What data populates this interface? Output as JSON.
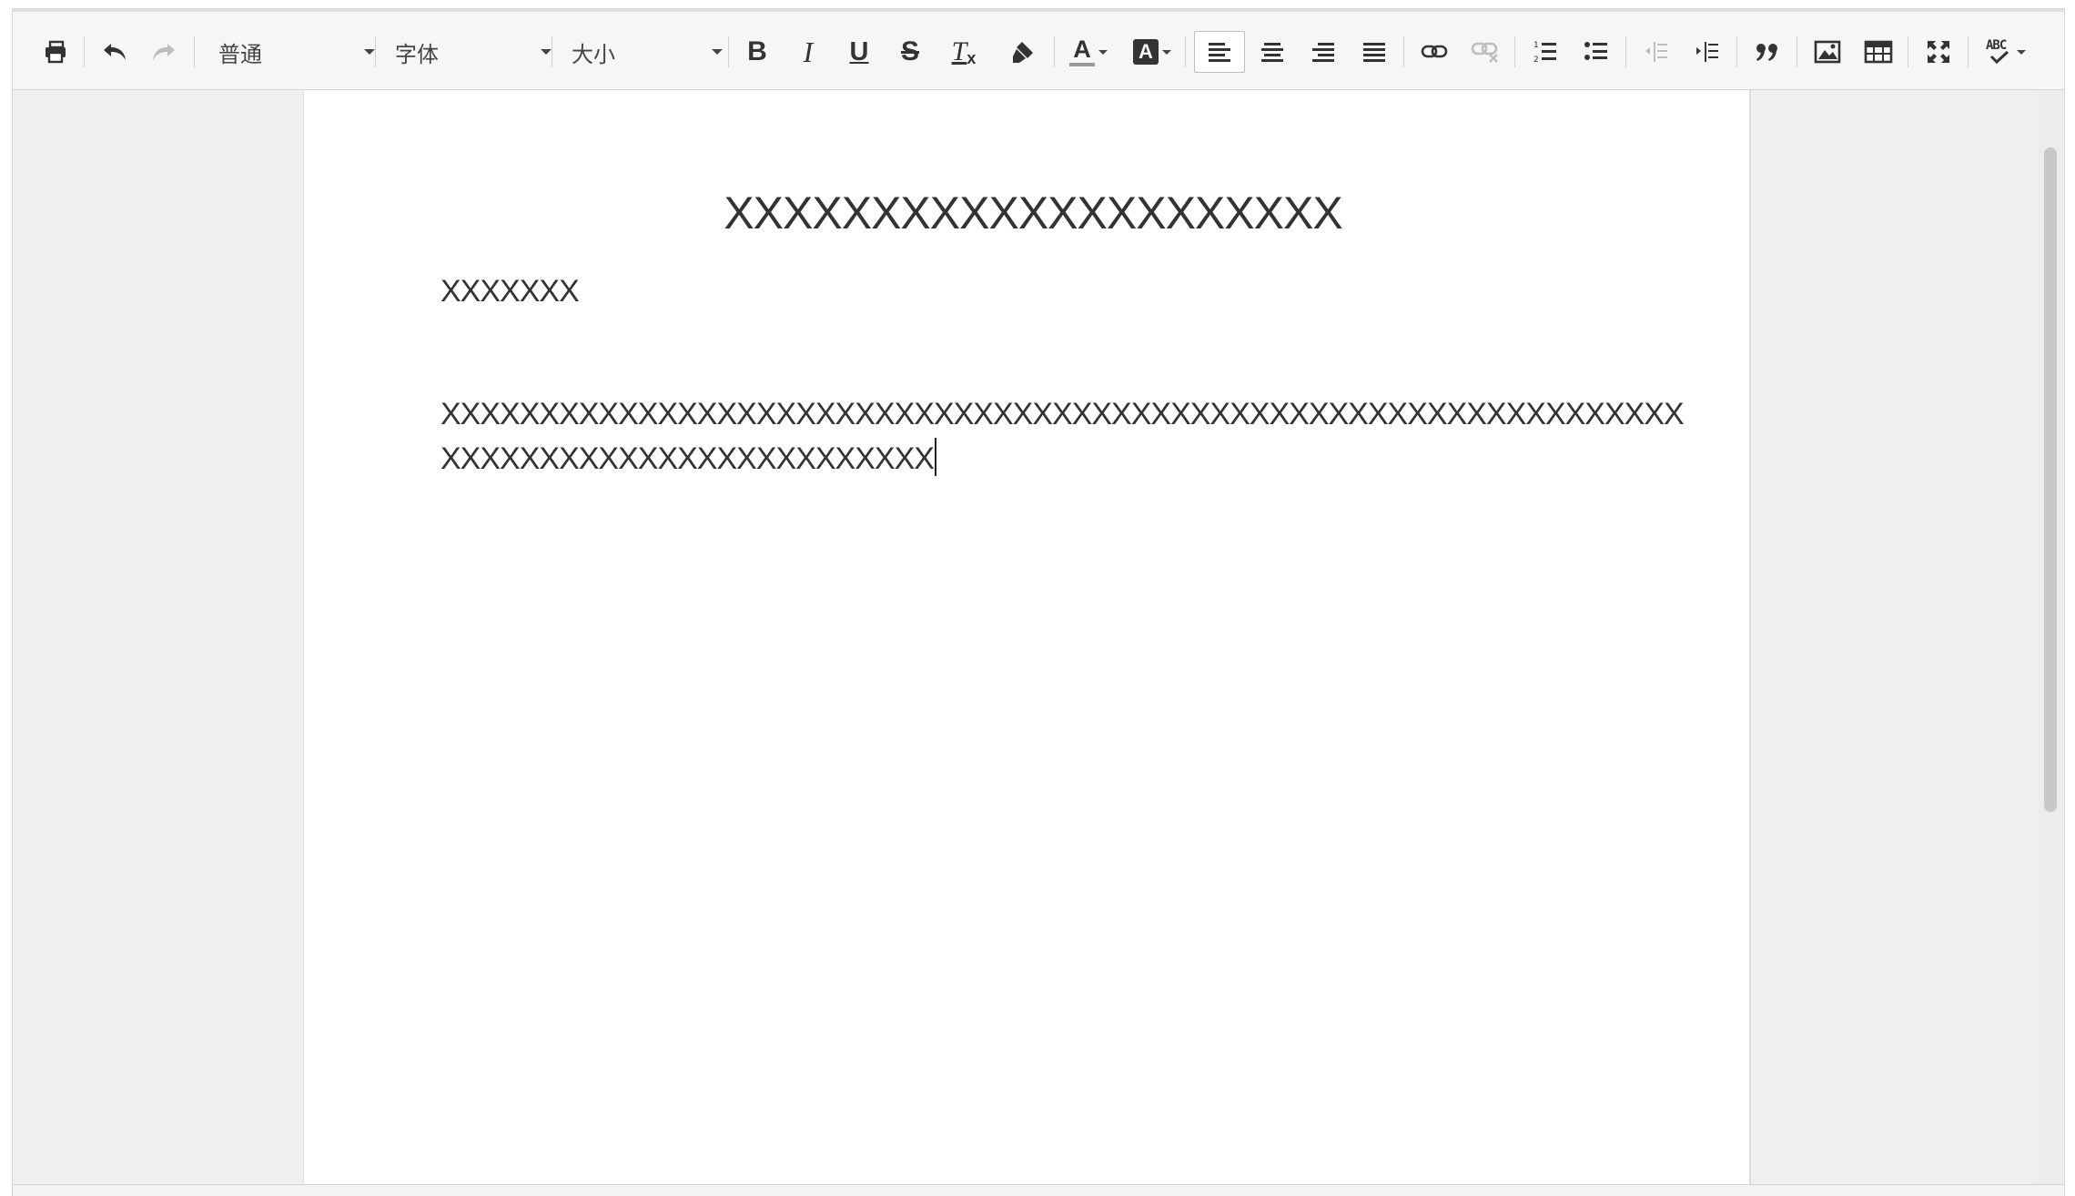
{
  "toolbar": {
    "paragraph_format": "普通",
    "font_family": "字体",
    "font_size": "大小",
    "buttons": {
      "print": "print-icon",
      "undo": "undo-icon",
      "redo": "redo-icon",
      "bold": "B",
      "italic": "I",
      "underline": "U",
      "strikethrough": "S",
      "clear_format": "T",
      "clear_format_sub": "x",
      "format_painter": "brush-icon",
      "font_color": "A",
      "bg_color": "A",
      "align_left": "align-left-icon",
      "align_center": "align-center-icon",
      "align_right": "align-right-icon",
      "align_justify": "align-justify-icon",
      "link": "link-icon",
      "unlink": "unlink-icon",
      "ordered_list": "ordered-list-icon",
      "bulleted_list": "bulleted-list-icon",
      "outdent": "outdent-icon",
      "indent": "indent-icon",
      "blockquote": "quote-icon",
      "image": "image-icon",
      "table": "table-icon",
      "fullscreen": "fullscreen-icon",
      "spellcheck": "ABC"
    },
    "active_alignment": "left"
  },
  "document": {
    "title": "XXXXXXXXXXXXXXXXXXXXX",
    "subtitle": "XXXXXXX",
    "body_lines": [
      "XXXXXXXXXXXXXXXXXXXXXXXXXXXXXXXXXXXXXXXXXXXXXXXXXXXXXXXXXXXXXXX",
      "XXXXXXXXXXXXXXXXXXXXXXXXX"
    ]
  },
  "colors": {
    "toolbar_bg": "#f6f6f6",
    "workspace_bg": "#efefef",
    "page_bg": "#ffffff",
    "text": "#333333",
    "disabled_icon": "#bdbdbd"
  }
}
